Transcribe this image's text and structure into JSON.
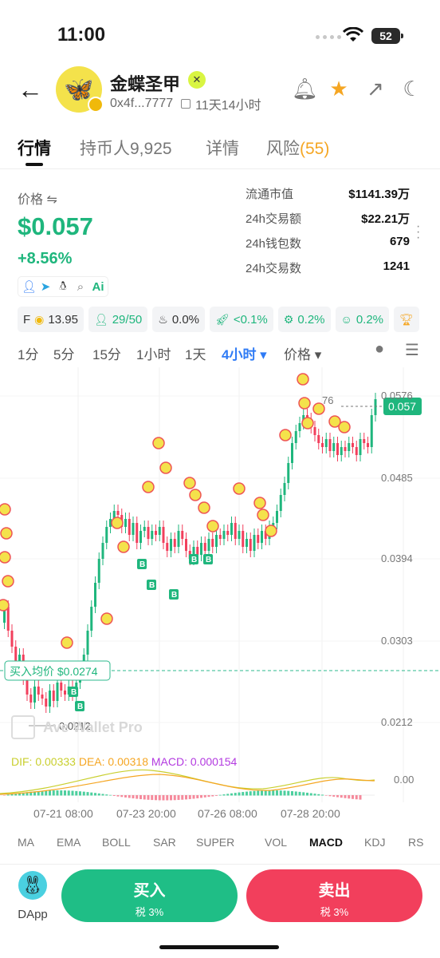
{
  "status": {
    "time": "11:00",
    "battery": "52"
  },
  "header": {
    "token_name": "金蝶圣甲",
    "address": "0x4f...7777",
    "age": "11天14小时"
  },
  "tabs": [
    {
      "label": "行情"
    },
    {
      "label": "持币人9,925"
    },
    {
      "label": "详情"
    },
    {
      "label": "风险",
      "count": "(55)"
    }
  ],
  "price": {
    "label": "价格 ⇋",
    "value": "$0.057",
    "change": "+8.56%"
  },
  "stats": [
    {
      "k": "流通市值",
      "v": "$1141.39万"
    },
    {
      "k": "24h交易额",
      "v": "$22.21万"
    },
    {
      "k": "24h钱包数",
      "v": "679"
    },
    {
      "k": "24h交易数",
      "v": "1241"
    }
  ],
  "chips": {
    "f_label": "F",
    "f_value": "13.95",
    "holders": "29/50",
    "c1": "0.0%",
    "c2": "<0.1%",
    "c3": "0.2%",
    "c4": "0.2%"
  },
  "timeframes": [
    "1分",
    "5分",
    "15分",
    "1小时",
    "1天",
    "4小时 ▾",
    "价格 ▾"
  ],
  "chart": {
    "y_ticks": [
      "0.0576",
      "0.0485",
      "0.0394",
      "0.0303",
      "0.0212"
    ],
    "x_ticks": [
      "07-21 08:00",
      "07-23 20:00",
      "07-26 08:00",
      "07-28 20:00"
    ],
    "current_price": "0.057",
    "avg_buy_label": "买入均价 $0.0274",
    "low_label": "0.0212",
    "high_label": "76",
    "watermark": "Ave Wallet Pro",
    "macd_zero": "0.00",
    "dif": "DIF: 0.00333",
    "dea": "DEA: 0.00318",
    "macd": "MACD: 0.000154",
    "colors": {
      "up": "#1fb67d",
      "down": "#f23f5c",
      "dif": "#c9cf2e",
      "dea": "#f5a623",
      "macd": "#b33ae0"
    }
  },
  "indicators": [
    "MA",
    "EMA",
    "BOLL",
    "SAR",
    "SUPER",
    "VOL",
    "MACD",
    "KDJ",
    "RS"
  ],
  "bottom": {
    "dapp": "DApp",
    "buy": "买入",
    "buy_tax": "税 3%",
    "sell": "卖出",
    "sell_tax": "税 3%"
  }
}
